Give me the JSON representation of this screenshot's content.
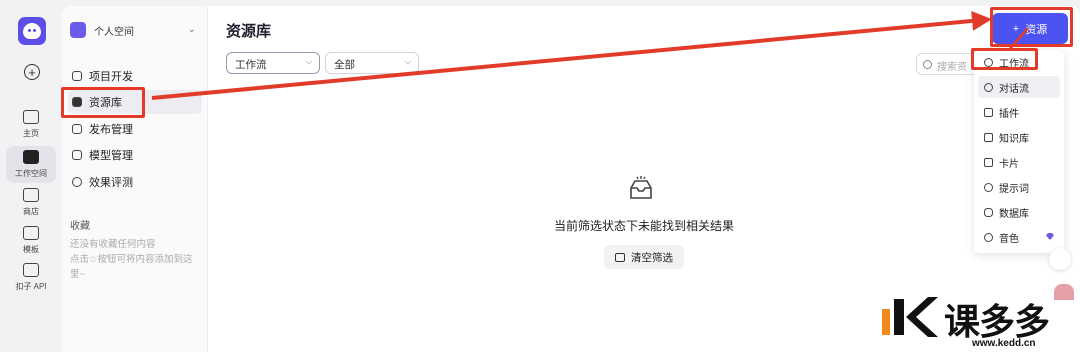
{
  "rail": {
    "items": [
      {
        "label": "主页"
      },
      {
        "label": "工作空间"
      },
      {
        "label": "商店"
      },
      {
        "label": "模板"
      },
      {
        "label": "扣子 API"
      }
    ]
  },
  "sidebar": {
    "space_name": "个人空间",
    "nav": [
      {
        "label": "项目开发"
      },
      {
        "label": "资源库"
      },
      {
        "label": "发布管理"
      },
      {
        "label": "模型管理"
      },
      {
        "label": "效果评测"
      }
    ],
    "favorites_title": "收藏",
    "favorites_empty_line1": "还没有收藏任何内容",
    "favorites_empty_line2": "点击☆按钮可将内容添加到这里~"
  },
  "main": {
    "title": "资源库",
    "filter_type": "工作流",
    "filter_scope": "全部",
    "search_placeholder": "搜索资",
    "add_button": "资源",
    "empty_text": "当前筛选状态下未能找到相关结果",
    "clear_button": "清空筛选"
  },
  "dropdown": {
    "items": [
      {
        "label": "工作流"
      },
      {
        "label": "对话流"
      },
      {
        "label": "插件"
      },
      {
        "label": "知识库"
      },
      {
        "label": "卡片"
      },
      {
        "label": "提示词"
      },
      {
        "label": "数据库"
      },
      {
        "label": "音色"
      }
    ]
  },
  "watermark": {
    "brand": "课多多",
    "url": "www.kedd.cn"
  },
  "colors": {
    "accent": "#4d53f0",
    "annotation": "#e23b2a",
    "brand_purple": "#5b4fe8"
  }
}
